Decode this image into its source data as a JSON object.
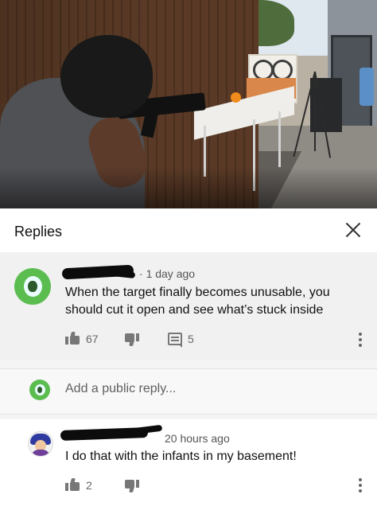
{
  "replies_panel": {
    "title": "Replies"
  },
  "comment1": {
    "timestamp": "1 day ago",
    "text_line1": "When the target finally becomes unusable, you",
    "text_line2": "should cut it open and see what’s stuck inside",
    "likes": "67",
    "replies": "5"
  },
  "add_reply": {
    "placeholder": "Add a public reply..."
  },
  "comment2": {
    "timestamp": "20 hours ago",
    "text": "I do that with the infants in my basement!",
    "likes": "2"
  },
  "icons": {
    "close": "close-icon",
    "like": "thumbs-up-icon",
    "dislike": "thumbs-down-icon",
    "reply": "reply-icon",
    "more": "more-vert-icon"
  },
  "colors": {
    "panel_bg": "#f1f1f1",
    "header_bg": "#ffffff",
    "icon_gray": "#777777",
    "avatar_green": "#5bbd4f"
  }
}
